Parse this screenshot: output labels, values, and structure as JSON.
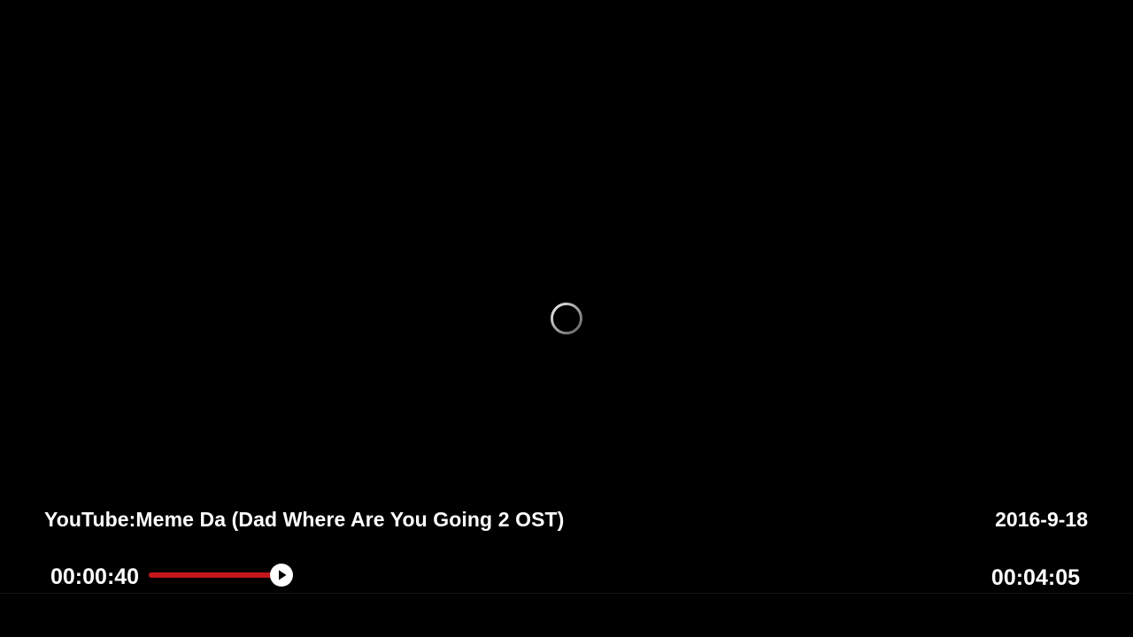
{
  "video": {
    "title": "YouTube:Meme Da (Dad Where Are You Going 2 OST)",
    "date": "2016-9-18"
  },
  "playback": {
    "current_time": "00:00:40",
    "total_time": "00:04:05",
    "progress_fraction": 0.1633,
    "state_icon": "play-icon",
    "loading_icon": "loading-spinner-icon"
  },
  "colors": {
    "background": "#000000",
    "progress_fill": "#c4161c",
    "text": "#ffffff"
  }
}
